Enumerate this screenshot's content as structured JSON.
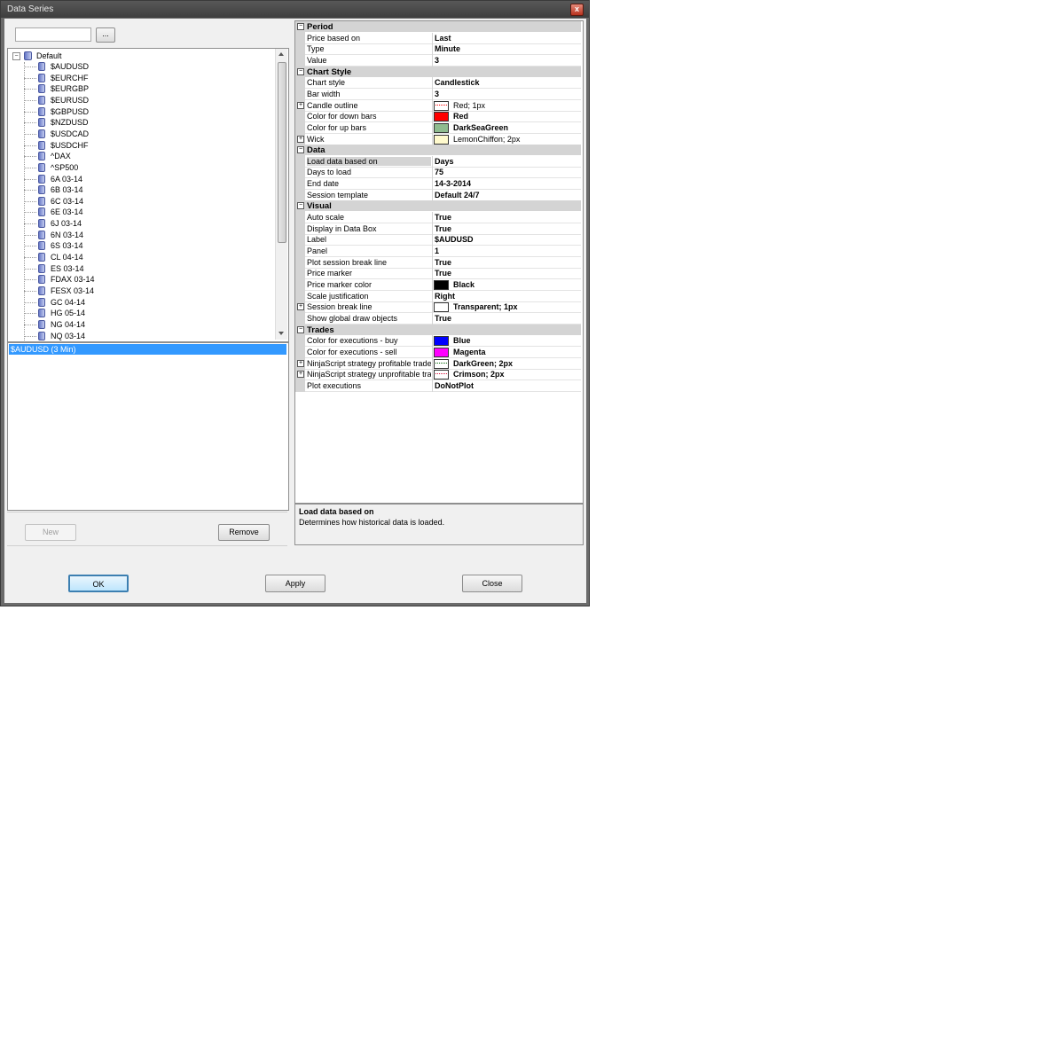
{
  "window": {
    "title": "Data Series",
    "close_glyph": "x"
  },
  "search": {
    "browse_label": "..."
  },
  "tree": {
    "root": "Default",
    "items": [
      "$AUDUSD",
      "$EURCHF",
      "$EURGBP",
      "$EURUSD",
      "$GBPUSD",
      "$NZDUSD",
      "$USDCAD",
      "$USDCHF",
      "^DAX",
      "^SP500",
      "6A 03-14",
      "6B 03-14",
      "6C 03-14",
      "6E 03-14",
      "6J 03-14",
      "6N 03-14",
      "6S 03-14",
      "CL 04-14",
      "ES 03-14",
      "FDAX 03-14",
      "FESX 03-14",
      "GC 04-14",
      "HG 05-14",
      "NG 04-14",
      "NQ 03-14"
    ]
  },
  "series_list": {
    "selected": "$AUDUSD (3 Min)"
  },
  "buttons": {
    "new": "New",
    "remove": "Remove",
    "ok": "OK",
    "apply": "Apply",
    "close": "Close"
  },
  "properties": [
    {
      "kind": "cat",
      "name": "Period"
    },
    {
      "kind": "prop",
      "name": "Price based on",
      "value": "Last"
    },
    {
      "kind": "prop",
      "name": "Type",
      "value": "Minute"
    },
    {
      "kind": "prop",
      "name": "Value",
      "value": "3"
    },
    {
      "kind": "cat",
      "name": "Chart Style"
    },
    {
      "kind": "prop",
      "name": "Chart style",
      "value": "Candlestick"
    },
    {
      "kind": "prop",
      "name": "Bar width",
      "value": "3"
    },
    {
      "kind": "prop",
      "name": "Candle outline",
      "value": "Red; 1px",
      "expand": true,
      "swatch": "#ffffff",
      "swatch_line": "#ff0000",
      "normal": true
    },
    {
      "kind": "prop",
      "name": "Color for down bars",
      "value": "Red",
      "swatch": "#ff0000"
    },
    {
      "kind": "prop",
      "name": "Color for up bars",
      "value": "DarkSeaGreen",
      "swatch": "#8fbc8f"
    },
    {
      "kind": "prop",
      "name": "Wick",
      "value": "LemonChiffon; 2px",
      "expand": true,
      "swatch": "#fffacd",
      "normal": true
    },
    {
      "kind": "cat",
      "name": "Data"
    },
    {
      "kind": "prop",
      "name": "Load data based on",
      "value": "Days",
      "selected": true
    },
    {
      "kind": "prop",
      "name": "Days to load",
      "value": "75"
    },
    {
      "kind": "prop",
      "name": "End date",
      "value": "14-3-2014"
    },
    {
      "kind": "prop",
      "name": "Session template",
      "value": "Default 24/7"
    },
    {
      "kind": "cat",
      "name": "Visual"
    },
    {
      "kind": "prop",
      "name": "Auto scale",
      "value": "True"
    },
    {
      "kind": "prop",
      "name": "Display in Data Box",
      "value": "True"
    },
    {
      "kind": "prop",
      "name": "Label",
      "value": "$AUDUSD"
    },
    {
      "kind": "prop",
      "name": "Panel",
      "value": "1"
    },
    {
      "kind": "prop",
      "name": "Plot session break line",
      "value": "True"
    },
    {
      "kind": "prop",
      "name": "Price marker",
      "value": "True"
    },
    {
      "kind": "prop",
      "name": "Price marker color",
      "value": "Black",
      "swatch": "#000000"
    },
    {
      "kind": "prop",
      "name": "Scale justification",
      "value": "Right"
    },
    {
      "kind": "prop",
      "name": "Session break line",
      "value": "Transparent; 1px",
      "expand": true,
      "swatch": "#ffffff"
    },
    {
      "kind": "prop",
      "name": "Show global draw objects",
      "value": "True"
    },
    {
      "kind": "cat",
      "name": "Trades"
    },
    {
      "kind": "prop",
      "name": "Color for executions - buy",
      "value": "Blue",
      "swatch": "#0000ff"
    },
    {
      "kind": "prop",
      "name": "Color for executions - sell",
      "value": "Magenta",
      "swatch": "#ff00ff"
    },
    {
      "kind": "prop",
      "name": "NinjaScript strategy profitable trade",
      "value": "DarkGreen; 2px",
      "expand": true,
      "swatch": "#ffffff",
      "swatch_line": "#006400"
    },
    {
      "kind": "prop",
      "name": "NinjaScript strategy unprofitable trade",
      "value": "Crimson; 2px",
      "expand": true,
      "swatch": "#ffffff",
      "swatch_line": "#dc143c"
    },
    {
      "kind": "prop",
      "name": "Plot executions",
      "value": "DoNotPlot"
    }
  ],
  "help": {
    "title": "Load data based on",
    "text": "Determines how historical data is loaded."
  }
}
